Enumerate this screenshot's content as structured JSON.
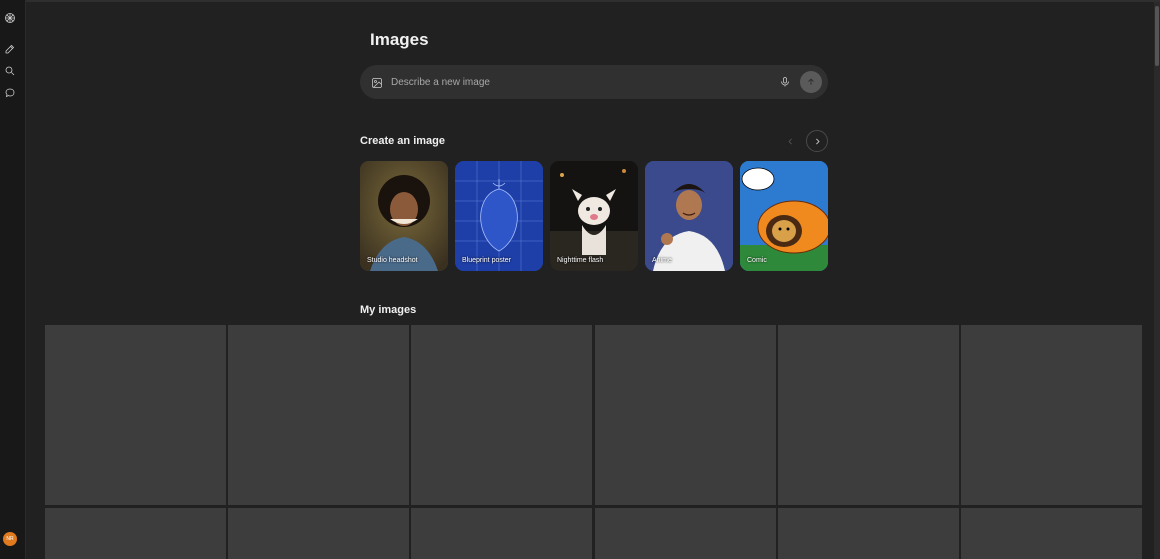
{
  "sidebar": {
    "icons": [
      "openai-logo-icon",
      "new-chat-icon",
      "search-icon",
      "chat-bubble-icon"
    ],
    "avatar_initials": "NR"
  },
  "page": {
    "title": "Images"
  },
  "prompt": {
    "placeholder": "Describe a new image",
    "icons": [
      "image-icon",
      "microphone-icon",
      "send-arrow-icon"
    ]
  },
  "create": {
    "heading": "Create an image",
    "cards": [
      {
        "label": "Studio headshot",
        "bg": "#5a4a2a"
      },
      {
        "label": "Blueprint poster",
        "bg": "#1f3fa8"
      },
      {
        "label": "Nighttime flash",
        "bg": "#1c1a18"
      },
      {
        "label": "Anime",
        "bg": "#3a4a8c"
      },
      {
        "label": "Comic",
        "bg": "#2d7bd0"
      }
    ]
  },
  "my_images": {
    "heading": "My images"
  }
}
